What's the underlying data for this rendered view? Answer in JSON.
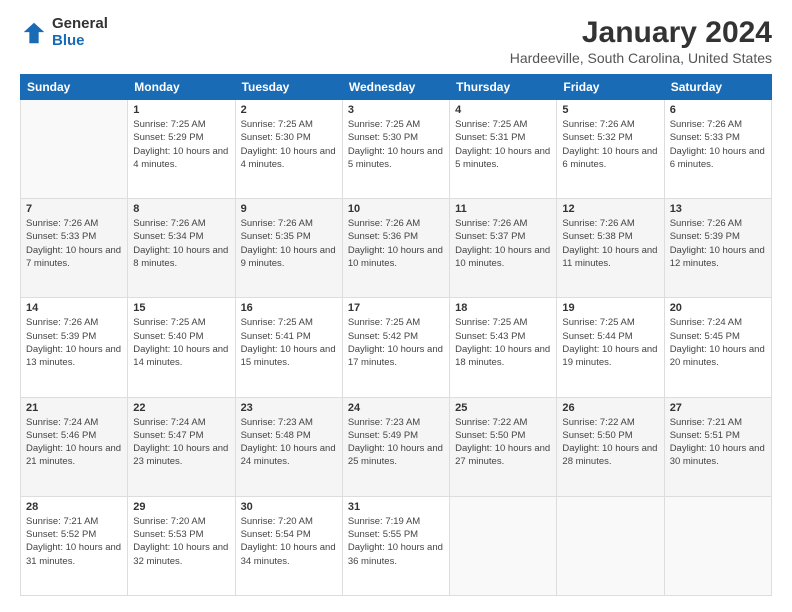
{
  "logo": {
    "general": "General",
    "blue": "Blue"
  },
  "title": "January 2024",
  "subtitle": "Hardeeville, South Carolina, United States",
  "headers": [
    "Sunday",
    "Monday",
    "Tuesday",
    "Wednesday",
    "Thursday",
    "Friday",
    "Saturday"
  ],
  "weeks": [
    [
      {
        "num": "",
        "info": ""
      },
      {
        "num": "1",
        "info": "Sunrise: 7:25 AM\nSunset: 5:29 PM\nDaylight: 10 hours\nand 4 minutes."
      },
      {
        "num": "2",
        "info": "Sunrise: 7:25 AM\nSunset: 5:30 PM\nDaylight: 10 hours\nand 4 minutes."
      },
      {
        "num": "3",
        "info": "Sunrise: 7:25 AM\nSunset: 5:30 PM\nDaylight: 10 hours\nand 5 minutes."
      },
      {
        "num": "4",
        "info": "Sunrise: 7:25 AM\nSunset: 5:31 PM\nDaylight: 10 hours\nand 5 minutes."
      },
      {
        "num": "5",
        "info": "Sunrise: 7:26 AM\nSunset: 5:32 PM\nDaylight: 10 hours\nand 6 minutes."
      },
      {
        "num": "6",
        "info": "Sunrise: 7:26 AM\nSunset: 5:33 PM\nDaylight: 10 hours\nand 6 minutes."
      }
    ],
    [
      {
        "num": "7",
        "info": "Sunrise: 7:26 AM\nSunset: 5:33 PM\nDaylight: 10 hours\nand 7 minutes."
      },
      {
        "num": "8",
        "info": "Sunrise: 7:26 AM\nSunset: 5:34 PM\nDaylight: 10 hours\nand 8 minutes."
      },
      {
        "num": "9",
        "info": "Sunrise: 7:26 AM\nSunset: 5:35 PM\nDaylight: 10 hours\nand 9 minutes."
      },
      {
        "num": "10",
        "info": "Sunrise: 7:26 AM\nSunset: 5:36 PM\nDaylight: 10 hours\nand 10 minutes."
      },
      {
        "num": "11",
        "info": "Sunrise: 7:26 AM\nSunset: 5:37 PM\nDaylight: 10 hours\nand 10 minutes."
      },
      {
        "num": "12",
        "info": "Sunrise: 7:26 AM\nSunset: 5:38 PM\nDaylight: 10 hours\nand 11 minutes."
      },
      {
        "num": "13",
        "info": "Sunrise: 7:26 AM\nSunset: 5:39 PM\nDaylight: 10 hours\nand 12 minutes."
      }
    ],
    [
      {
        "num": "14",
        "info": "Sunrise: 7:26 AM\nSunset: 5:39 PM\nDaylight: 10 hours\nand 13 minutes."
      },
      {
        "num": "15",
        "info": "Sunrise: 7:25 AM\nSunset: 5:40 PM\nDaylight: 10 hours\nand 14 minutes."
      },
      {
        "num": "16",
        "info": "Sunrise: 7:25 AM\nSunset: 5:41 PM\nDaylight: 10 hours\nand 15 minutes."
      },
      {
        "num": "17",
        "info": "Sunrise: 7:25 AM\nSunset: 5:42 PM\nDaylight: 10 hours\nand 17 minutes."
      },
      {
        "num": "18",
        "info": "Sunrise: 7:25 AM\nSunset: 5:43 PM\nDaylight: 10 hours\nand 18 minutes."
      },
      {
        "num": "19",
        "info": "Sunrise: 7:25 AM\nSunset: 5:44 PM\nDaylight: 10 hours\nand 19 minutes."
      },
      {
        "num": "20",
        "info": "Sunrise: 7:24 AM\nSunset: 5:45 PM\nDaylight: 10 hours\nand 20 minutes."
      }
    ],
    [
      {
        "num": "21",
        "info": "Sunrise: 7:24 AM\nSunset: 5:46 PM\nDaylight: 10 hours\nand 21 minutes."
      },
      {
        "num": "22",
        "info": "Sunrise: 7:24 AM\nSunset: 5:47 PM\nDaylight: 10 hours\nand 23 minutes."
      },
      {
        "num": "23",
        "info": "Sunrise: 7:23 AM\nSunset: 5:48 PM\nDaylight: 10 hours\nand 24 minutes."
      },
      {
        "num": "24",
        "info": "Sunrise: 7:23 AM\nSunset: 5:49 PM\nDaylight: 10 hours\nand 25 minutes."
      },
      {
        "num": "25",
        "info": "Sunrise: 7:22 AM\nSunset: 5:50 PM\nDaylight: 10 hours\nand 27 minutes."
      },
      {
        "num": "26",
        "info": "Sunrise: 7:22 AM\nSunset: 5:50 PM\nDaylight: 10 hours\nand 28 minutes."
      },
      {
        "num": "27",
        "info": "Sunrise: 7:21 AM\nSunset: 5:51 PM\nDaylight: 10 hours\nand 30 minutes."
      }
    ],
    [
      {
        "num": "28",
        "info": "Sunrise: 7:21 AM\nSunset: 5:52 PM\nDaylight: 10 hours\nand 31 minutes."
      },
      {
        "num": "29",
        "info": "Sunrise: 7:20 AM\nSunset: 5:53 PM\nDaylight: 10 hours\nand 32 minutes."
      },
      {
        "num": "30",
        "info": "Sunrise: 7:20 AM\nSunset: 5:54 PM\nDaylight: 10 hours\nand 34 minutes."
      },
      {
        "num": "31",
        "info": "Sunrise: 7:19 AM\nSunset: 5:55 PM\nDaylight: 10 hours\nand 36 minutes."
      },
      {
        "num": "",
        "info": ""
      },
      {
        "num": "",
        "info": ""
      },
      {
        "num": "",
        "info": ""
      }
    ]
  ]
}
